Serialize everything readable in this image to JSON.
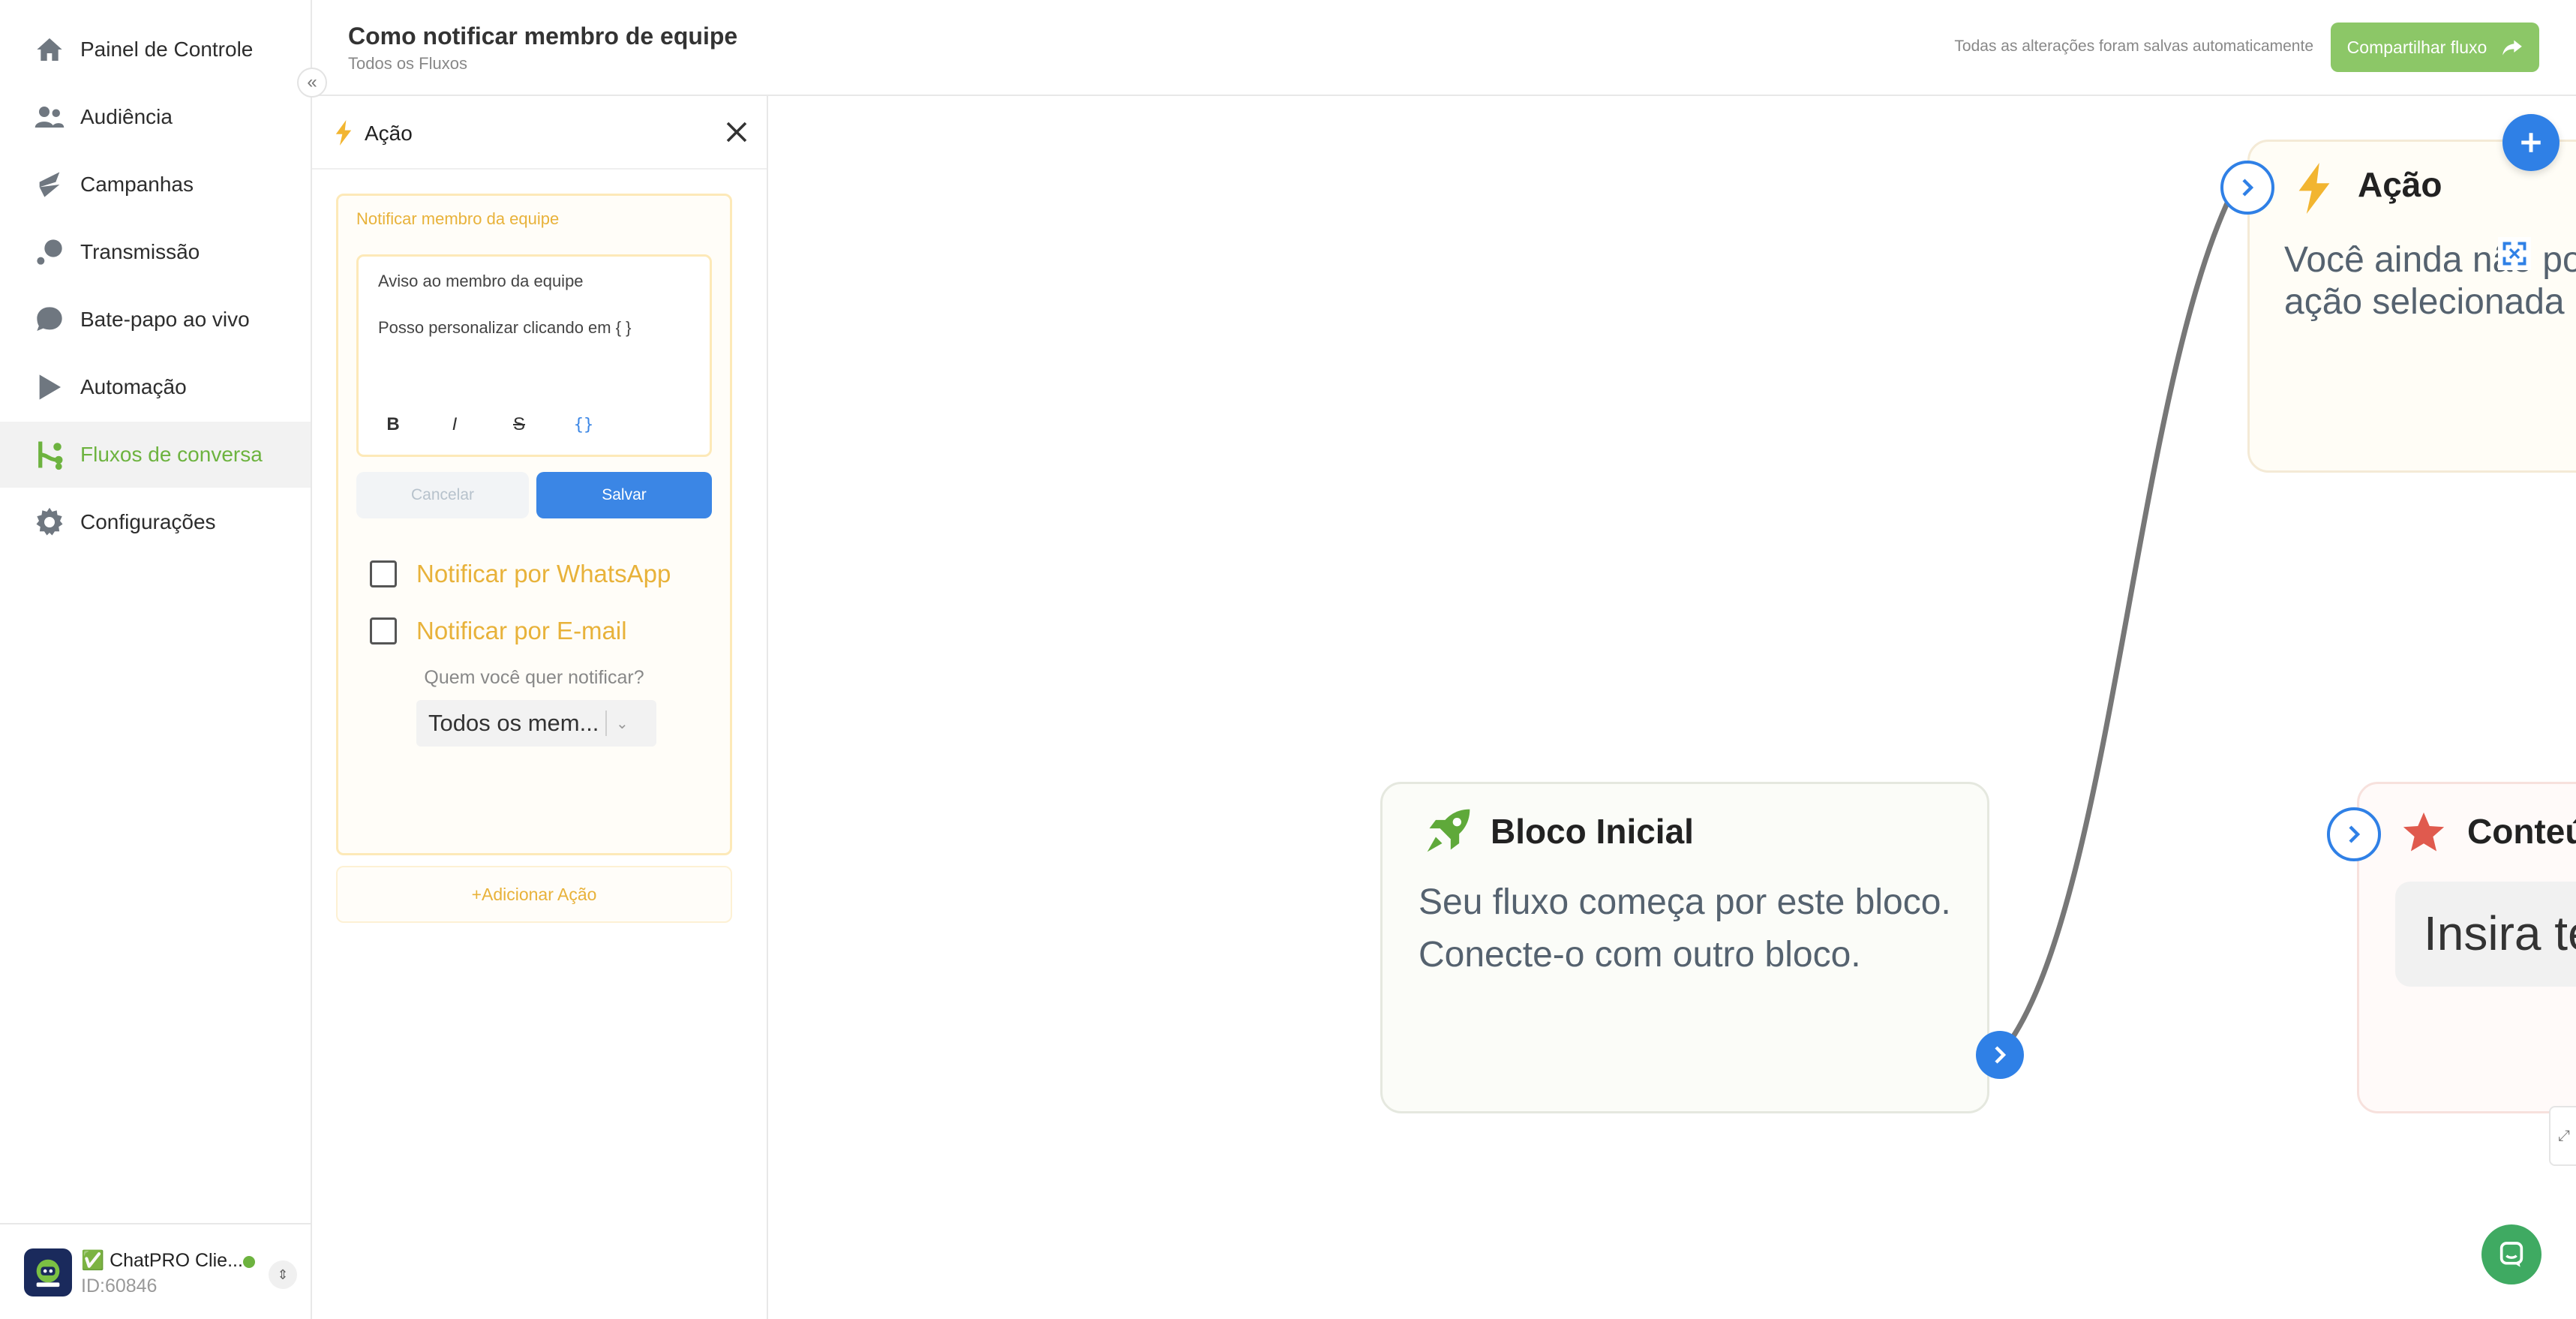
{
  "colors": {
    "accent_green": "#6db33f",
    "primary_blue": "#3b86e5",
    "action_yellow": "#e8b23a",
    "share_button": "#8cc767",
    "chat_button": "#3faa62"
  },
  "sidebar": {
    "items": [
      {
        "label": "Painel de Controle",
        "icon": "home-icon"
      },
      {
        "label": "Audiência",
        "icon": "users-icon"
      },
      {
        "label": "Campanhas",
        "icon": "campaign-icon"
      },
      {
        "label": "Transmissão",
        "icon": "broadcast-icon"
      },
      {
        "label": "Bate-papo ao vivo",
        "icon": "chat-bubble-icon"
      },
      {
        "label": "Automação",
        "icon": "play-icon"
      },
      {
        "label": "Fluxos de conversa",
        "icon": "flow-icon",
        "active": true
      },
      {
        "label": "Configurações",
        "icon": "gear-icon"
      }
    ],
    "collapse_icon": "double-chevron-left-icon",
    "account": {
      "name": "✅ ChatPRO Clie...",
      "id": "ID:60846",
      "status": "online"
    }
  },
  "header": {
    "title": "Como notificar membro de equipe",
    "breadcrumb": "Todos os Fluxos",
    "autosave": "Todas as alterações foram salvas automaticamente",
    "share_label": "Compartilhar fluxo"
  },
  "panel": {
    "title": "Ação",
    "notify": {
      "title": "Notificar membro da equipe",
      "editor_line1": "Aviso ao membro da equipe",
      "editor_line2": "Posso personalizar clicando em { }",
      "format_buttons": [
        "B",
        "I",
        "S",
        "{}"
      ],
      "cancel_label": "Cancelar",
      "save_label": "Salvar",
      "whatsapp_label": "Notificar por WhatsApp",
      "whatsapp_checked": false,
      "email_label": "Notificar por E-mail",
      "email_checked": false,
      "who_label": "Quem você quer notificar?",
      "who_value": "Todos os mem..."
    },
    "add_action_label": "+Adicionar Ação"
  },
  "canvas": {
    "start_node": {
      "title": "Bloco Inicial",
      "desc_line1": "Seu fluxo começa por este bloco.",
      "desc_line2": "Conecte-o com outro bloco."
    },
    "action_node": {
      "title": "Ação",
      "desc_line1": "Você ainda não po",
      "desc_line2": "ação selecionada"
    },
    "content_node": {
      "title": "Conteú",
      "input_text": "Insira te"
    }
  }
}
